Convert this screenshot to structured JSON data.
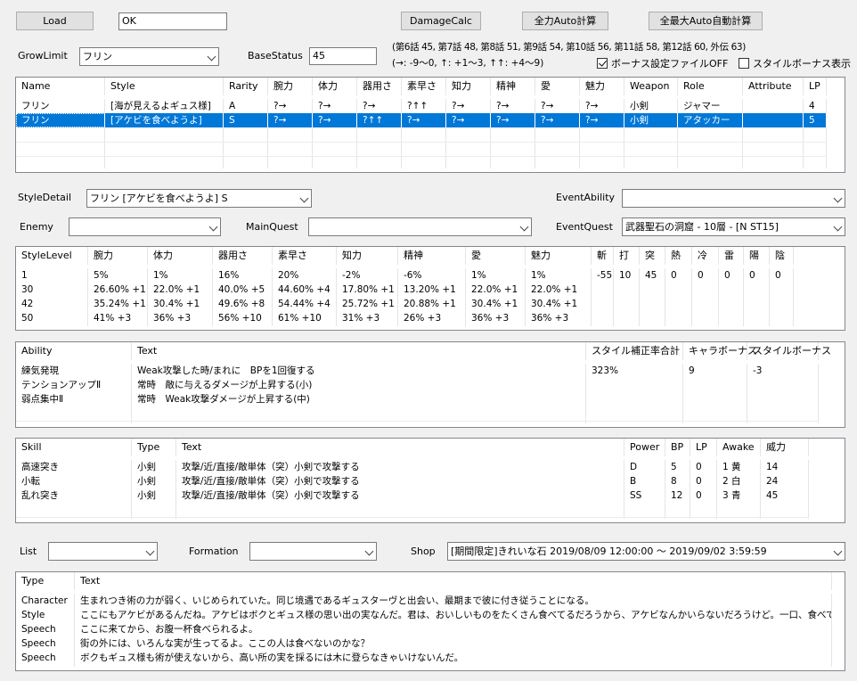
{
  "toolbar": {
    "load": "Load",
    "result": "OK",
    "damage_calc": "DamageCalc",
    "auto_calc": "全力Auto計算",
    "max_auto_calc": "全最大Auto自動計算"
  },
  "settings": {
    "grow_limit_label": "GrowLimit",
    "grow_limit_value": "フリン",
    "base_status_label": "BaseStatus",
    "base_status_value": "45",
    "chapter_info": "(第6話 45, 第7話 48, 第8話 51, 第9話 54, 第10話 56, 第11話 58, 第12話 60, 外伝 63)",
    "arrow_info": "(→: -9〜0, ↑: +1〜3, ↑↑: +4〜9)",
    "bonus_file_off": "ボーナス設定ファイルOFF",
    "bonus_file_checked": true,
    "style_bonus_show": "スタイルボーナス表示",
    "style_bonus_checked": false
  },
  "style_list": {
    "columns": [
      "Name",
      "Style",
      "Rarity",
      "腕力",
      "体力",
      "器用さ",
      "素早さ",
      "知力",
      "精神",
      "愛",
      "魅力",
      "Weapon",
      "Role",
      "Attribute",
      "LP"
    ],
    "rows": [
      [
        "フリン",
        "[海が見えるよギュス様]",
        "A",
        "?→",
        "?→",
        "?→",
        "?↑↑",
        "?→",
        "?→",
        "?→",
        "?→",
        "小剣",
        "ジャマー",
        "",
        "4"
      ],
      [
        "フリン",
        "[アケビを食べようよ]",
        "S",
        "?→",
        "?→",
        "?↑↑",
        "?→",
        "?→",
        "?→",
        "?→",
        "?→",
        "小剣",
        "アタッカー",
        "",
        "5"
      ]
    ]
  },
  "selectors": {
    "style_detail_label": "StyleDetail",
    "style_detail_value": "フリン [アケビを食べようよ] S",
    "event_ability_label": "EventAbility",
    "event_ability_value": "",
    "enemy_label": "Enemy",
    "enemy_value": "",
    "main_quest_label": "MainQuest",
    "main_quest_value": "",
    "event_quest_label": "EventQuest",
    "event_quest_value": "武器聖石の洞窟 - 10層 - [N ST15]"
  },
  "level_table": {
    "columns": [
      "StyleLevel",
      "腕力",
      "体力",
      "器用さ",
      "素早さ",
      "知力",
      "精神",
      "愛",
      "魅力",
      "斬",
      "打",
      "突",
      "熱",
      "冷",
      "雷",
      "陽",
      "陰"
    ],
    "rows": [
      [
        "1",
        "5%",
        "1%",
        "16%",
        "20%",
        "-2%",
        "-6%",
        "1%",
        "1%",
        "-55",
        "10",
        "45",
        "0",
        "0",
        "0",
        "0",
        "0"
      ],
      [
        "30",
        "26.60% +1",
        "22.0% +1",
        "40.0% +5",
        "44.60% +4",
        "17.80% +1",
        "13.20% +1",
        "22.0% +1",
        "22.0% +1",
        "",
        "",
        "",
        "",
        "",
        "",
        "",
        ""
      ],
      [
        "42",
        "35.24% +1",
        "30.4% +1",
        "49.6% +8",
        "54.44% +4",
        "25.72% +1",
        "20.88% +1",
        "30.4% +1",
        "30.4% +1",
        "",
        "",
        "",
        "",
        "",
        "",
        "",
        ""
      ],
      [
        "50",
        "41% +3",
        "36% +3",
        "56% +10",
        "61% +10",
        "31% +3",
        "26% +3",
        "36% +3",
        "36% +3",
        "",
        "",
        "",
        "",
        "",
        "",
        "",
        ""
      ]
    ]
  },
  "ability_table": {
    "columns": [
      "Ability",
      "Text",
      "スタイル補正率合計",
      "キャラボーナス",
      "スタイルボーナス"
    ],
    "rows": [
      [
        "練気発現",
        "Weak攻撃した時/まれに　BPを1回復する",
        "323%",
        "9",
        "-3"
      ],
      [
        "テンションアップⅡ",
        "常時　敵に与えるダメージが上昇する(小)",
        "",
        "",
        ""
      ],
      [
        "弱点集中Ⅱ",
        "常時　Weak攻撃ダメージが上昇する(中)",
        "",
        "",
        ""
      ]
    ]
  },
  "skill_table": {
    "columns": [
      "Skill",
      "Type",
      "Text",
      "Power",
      "BP",
      "LP",
      "Awake",
      "威力"
    ],
    "rows": [
      [
        "高速突き",
        "小剣",
        "攻撃/近/直接/敵単体（突）小剣で攻撃する",
        "D",
        "5",
        "0",
        "1 黄",
        "14"
      ],
      [
        "小転",
        "小剣",
        "攻撃/近/直接/敵単体（突）小剣で攻撃する",
        "B",
        "8",
        "0",
        "2 白",
        "24"
      ],
      [
        "乱れ突き",
        "小剣",
        "攻撃/近/直接/敵単体（突）小剣で攻撃する",
        "SS",
        "12",
        "0",
        "3 青",
        "45"
      ]
    ]
  },
  "bottom_selectors": {
    "list_label": "List",
    "list_value": "",
    "formation_label": "Formation",
    "formation_value": "",
    "shop_label": "Shop",
    "shop_value": "[期間限定]きれいな石 2019/08/09 12:00:00 〜 2019/09/02 3:59:59"
  },
  "text_table": {
    "columns": [
      "Type",
      "Text"
    ],
    "rows": [
      [
        "Character",
        "生まれつき術の力が弱く、いじめられていた。同じ境遇であるギュスターヴと出会い、最期まで彼に付き従うことになる。"
      ],
      [
        "Style",
        "ここにもアケビがあるんだね。アケビはボクとギュス様の思い出の実なんだ。君は、おいしいものをたくさん食べてるだろうから、アケビなんかいらないだろうけど。一口、食べてみて。"
      ],
      [
        "Speech",
        "ここに来てから、お腹一杯食べられるよ。"
      ],
      [
        "Speech",
        "街の外には、いろんな実が生ってるよ。ここの人は食べないのかな？"
      ],
      [
        "Speech",
        "ボクもギュス様も術が使えないから、高い所の実を採るには木に登らなきゃいけないんだ。"
      ]
    ]
  }
}
